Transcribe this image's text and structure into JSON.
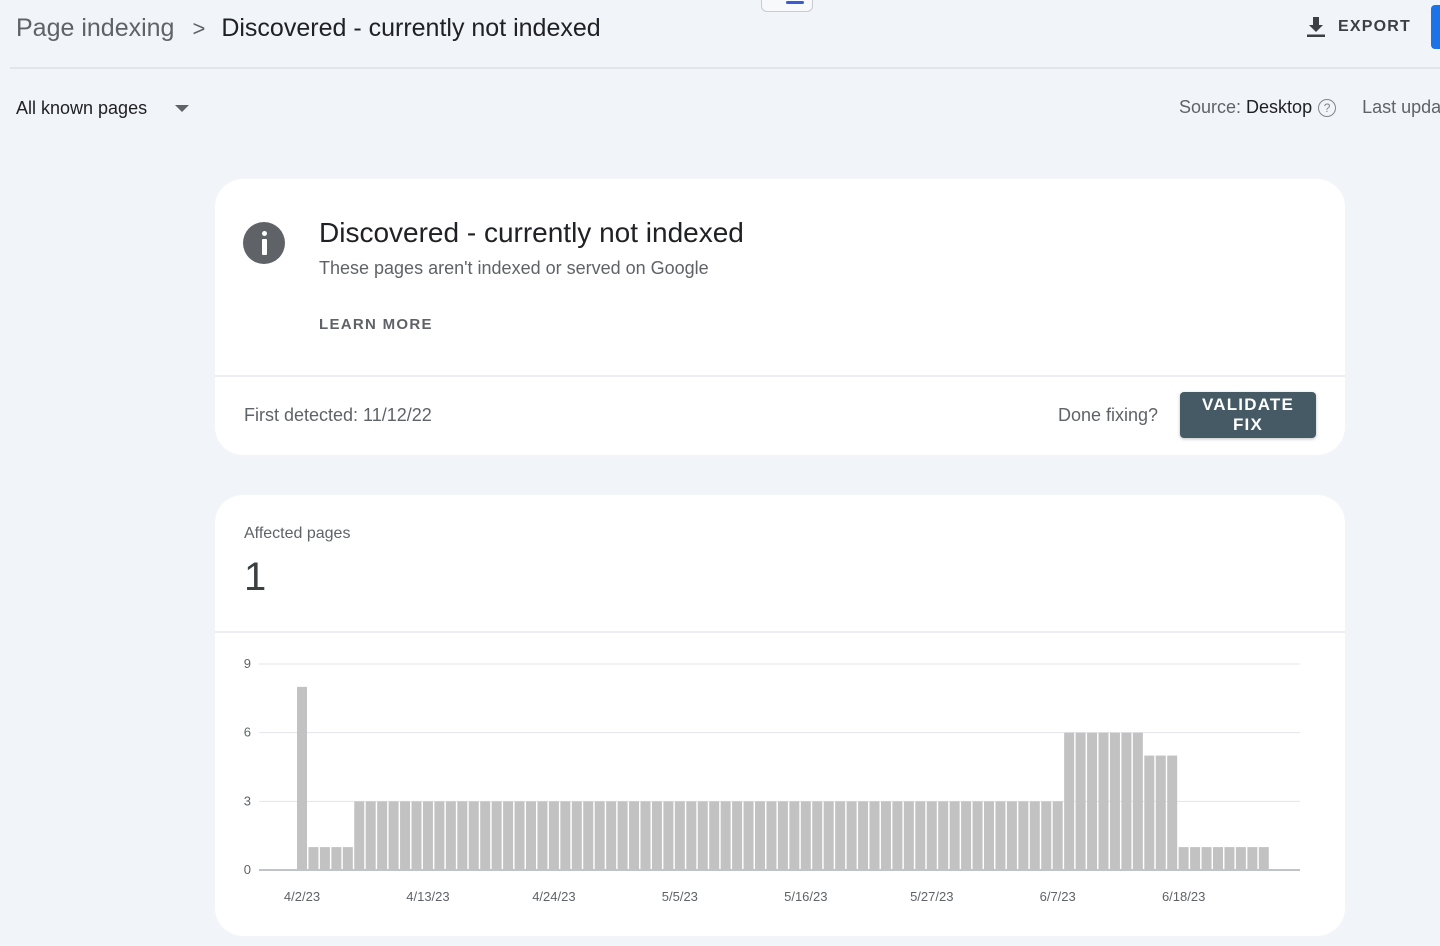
{
  "header": {
    "breadcrumb_parent": "Page indexing",
    "breadcrumb_separator": ">",
    "breadcrumb_current": "Discovered - currently not indexed",
    "export_label": "EXPORT"
  },
  "filters": {
    "scope_label": "All known pages",
    "source_label": "Source:",
    "source_value": "Desktop",
    "help_glyph": "?",
    "last_updated_label": "Last upda"
  },
  "issue": {
    "title": "Discovered - currently not indexed",
    "subtitle": "These pages aren't indexed or served on Google",
    "learn_more": "LEARN MORE",
    "first_detected": "First detected: 11/12/22",
    "done_fixing": "Done fixing?",
    "validate_fix": "VALIDATE FIX"
  },
  "affected": {
    "label": "Affected pages",
    "count": "1"
  },
  "chart_data": {
    "type": "bar",
    "title": "",
    "xlabel": "",
    "ylabel": "",
    "ylim": [
      0,
      9
    ],
    "yticks": [
      0,
      3,
      6,
      9
    ],
    "grid": true,
    "x_tick_labels": [
      "4/2/23",
      "4/13/23",
      "4/24/23",
      "5/5/23",
      "5/16/23",
      "5/27/23",
      "6/7/23",
      "6/18/23"
    ],
    "x_tick_stride": 11,
    "bar_color": "#c2c2c2",
    "values": [
      8,
      1,
      1,
      1,
      1,
      3,
      3,
      3,
      3,
      3,
      3,
      3,
      3,
      3,
      3,
      3,
      3,
      3,
      3,
      3,
      3,
      3,
      3,
      3,
      3,
      3,
      3,
      3,
      3,
      3,
      3,
      3,
      3,
      3,
      3,
      3,
      3,
      3,
      3,
      3,
      3,
      3,
      3,
      3,
      3,
      3,
      3,
      3,
      3,
      3,
      3,
      3,
      3,
      3,
      3,
      3,
      3,
      3,
      3,
      3,
      3,
      3,
      3,
      3,
      3,
      3,
      3,
      6,
      6,
      6,
      6,
      6,
      6,
      6,
      5,
      5,
      5,
      1,
      1,
      1,
      1,
      1,
      1,
      1,
      1
    ]
  },
  "colors": {
    "page_bg": "#f1f4f9",
    "card_bg": "#ffffff",
    "button_bg": "#455a64",
    "accent": "#1a73e8"
  }
}
